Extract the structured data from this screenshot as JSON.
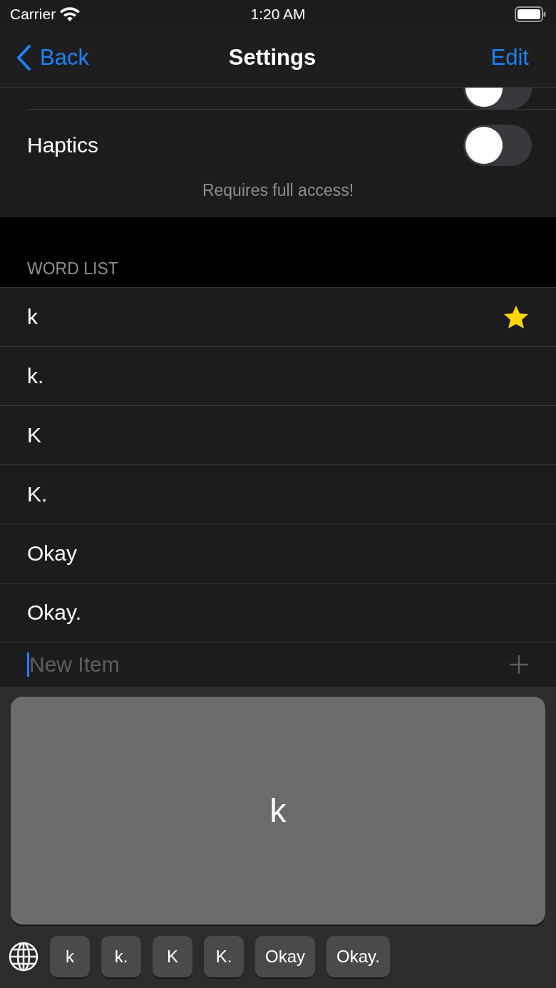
{
  "status_bar": {
    "carrier": "Carrier",
    "time": "1:20 AM"
  },
  "nav": {
    "back": "Back",
    "title": "Settings",
    "action": "Edit"
  },
  "settings": {
    "hidden_row_toggle": {
      "on": false
    },
    "rows": [
      {
        "label": "Haptics",
        "on": false
      }
    ],
    "footer": "Requires full access!"
  },
  "word_list": {
    "header": "WORD LIST",
    "items": [
      {
        "text": "k",
        "starred": true
      },
      {
        "text": "k.",
        "starred": false
      },
      {
        "text": "K",
        "starred": false
      },
      {
        "text": "K.",
        "starred": false
      },
      {
        "text": "Okay",
        "starred": false
      },
      {
        "text": "Okay.",
        "starred": false
      }
    ],
    "new_item": {
      "placeholder": "New Item"
    }
  },
  "keyboard": {
    "key_preview": "k",
    "suggestions": [
      "k",
      "k.",
      "K",
      "K.",
      "Okay",
      "Okay."
    ]
  }
}
